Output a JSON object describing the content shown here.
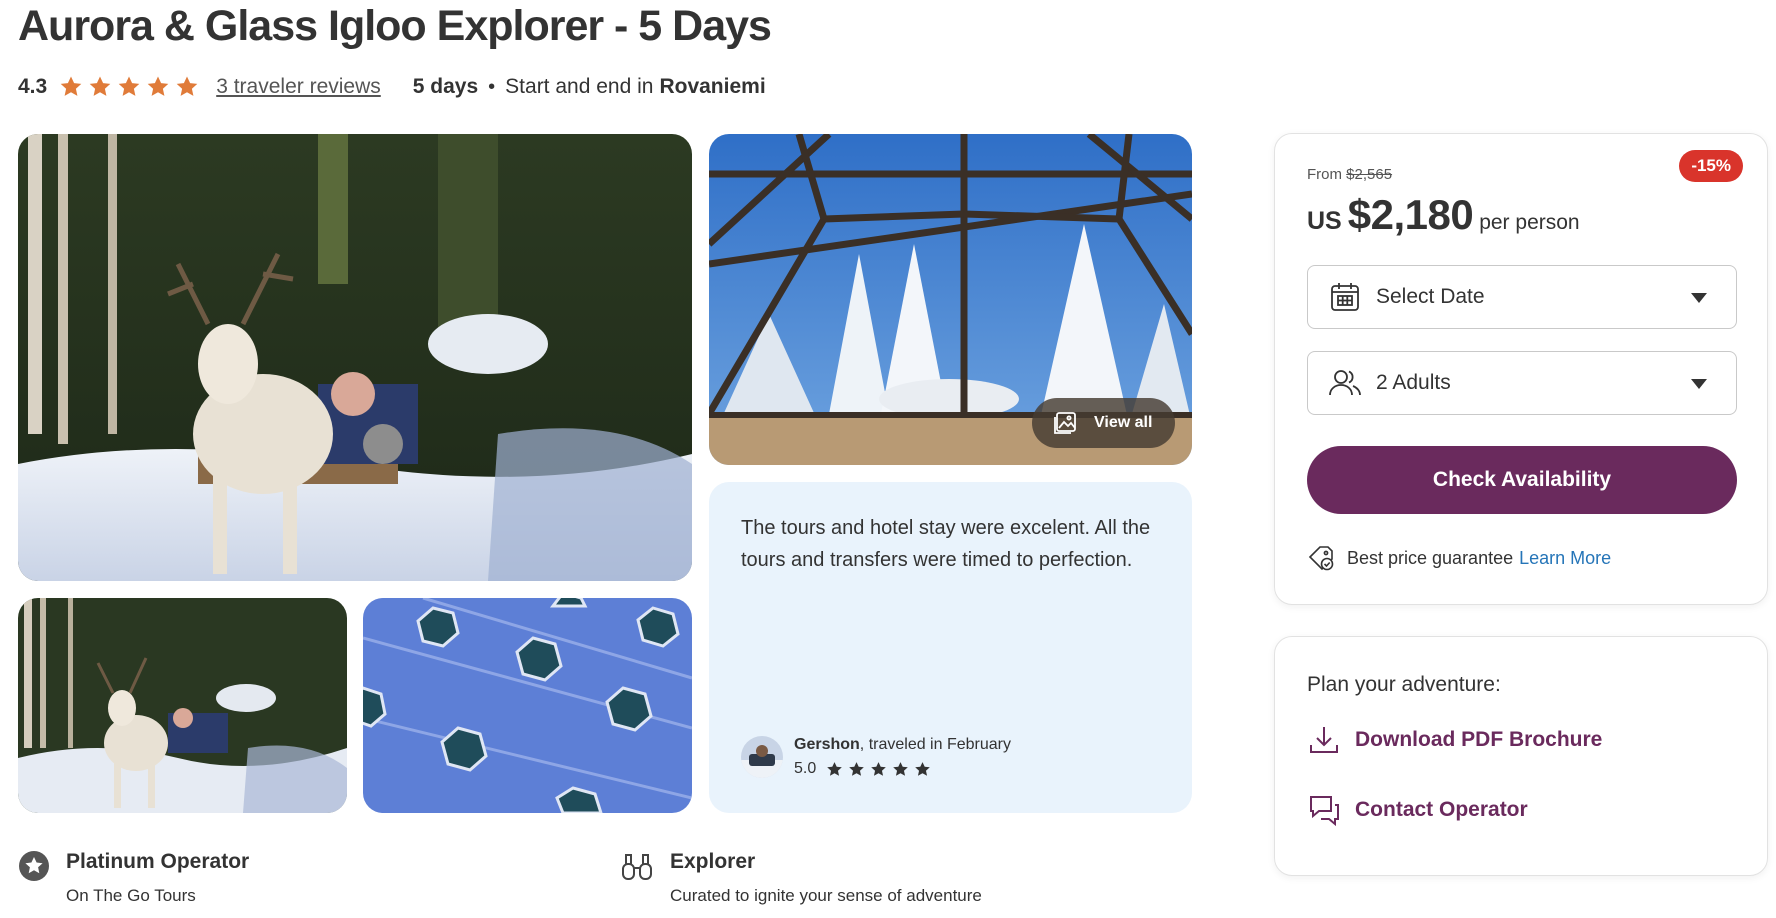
{
  "header": {
    "title": "Aurora & Glass Igloo Explorer - 5 Days",
    "rating": "4.3",
    "star_count": 4.5,
    "reviews_link": "3 traveler reviews",
    "duration": "5 days",
    "separator": "•",
    "start_end_prefix": "Start and end in",
    "city": "Rovaniemi"
  },
  "gallery": {
    "view_all_label": "View all"
  },
  "review": {
    "text": "The tours and hotel stay were excelent. All the tours and transfers were timed to perfection.",
    "reviewer_name": "Gershon",
    "reviewer_suffix": ", traveled in February",
    "score": "5.0"
  },
  "badges": [
    {
      "title": "Platinum Operator",
      "subtitle": "On The Go Tours",
      "icon": "star-badge-icon"
    },
    {
      "title": "Explorer",
      "subtitle": "Curated to ignite your sense of adventure",
      "icon": "binoculars-icon"
    }
  ],
  "booking": {
    "from_label": "From",
    "original_price": "$2,565",
    "discount": "-15%",
    "currency": "US",
    "price": "$2,180",
    "per_person": "per person",
    "date_select": "Select Date",
    "guests_select": "2 Adults",
    "check_button": "Check Availability",
    "guarantee_text": "Best price guarantee",
    "learn_more": "Learn More"
  },
  "plan": {
    "title": "Plan your adventure:",
    "pdf_link": "Download PDF Brochure",
    "contact_link": "Contact Operator"
  },
  "colors": {
    "brand": "#6a2a5d",
    "star": "#e07b39",
    "discount": "#d9342b",
    "link": "#2575b8",
    "review_bg": "#e9f3fc"
  }
}
